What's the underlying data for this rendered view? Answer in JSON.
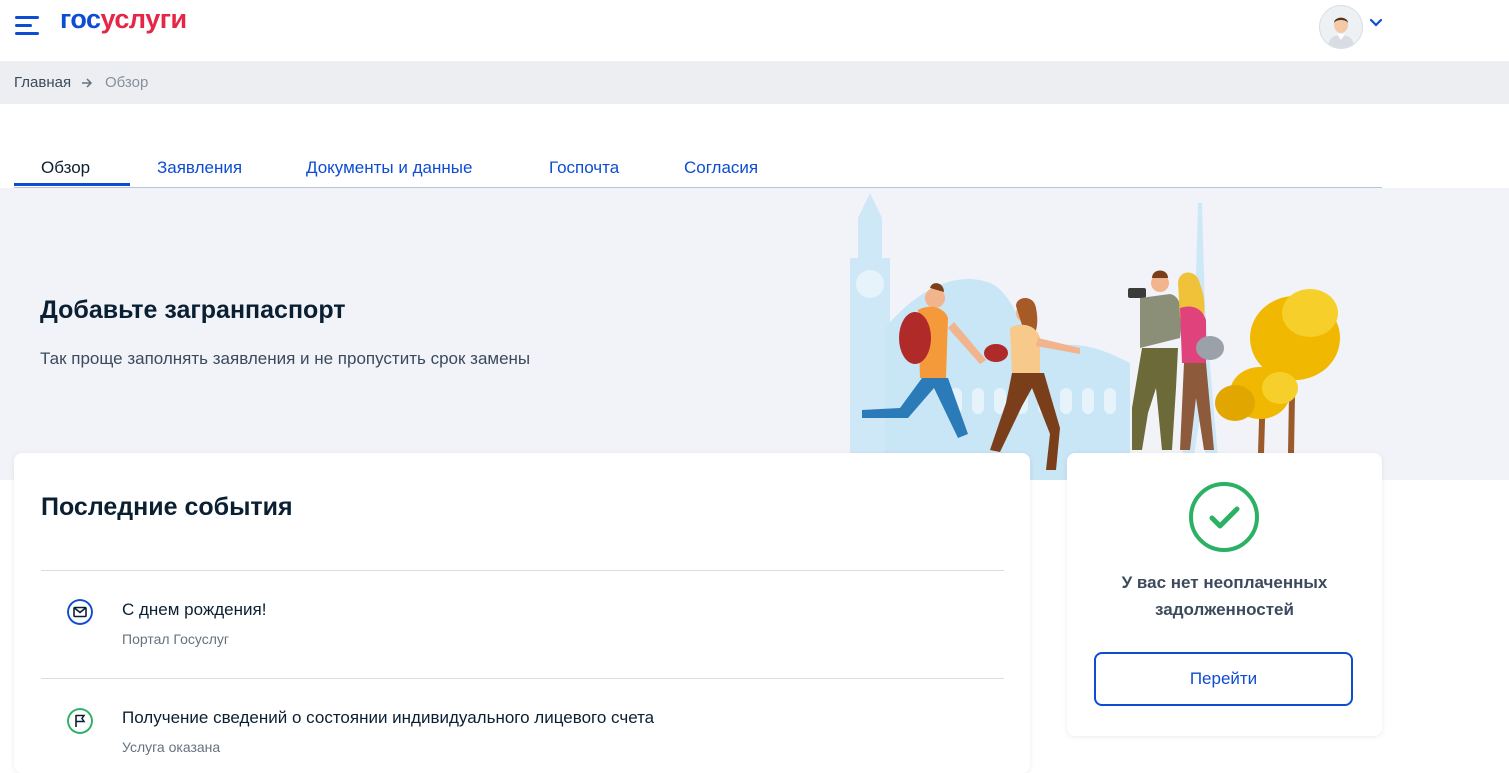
{
  "header": {
    "logo_part1": "гос",
    "logo_part2": "услуги",
    "menu_icon": "hamburger-icon",
    "avatar_icon": "user-avatar",
    "dropdown_icon": "chevron-down-icon"
  },
  "breadcrumb": {
    "home": "Главная",
    "separator_icon": "arrow-right-icon",
    "current": "Обзор"
  },
  "tabs": [
    {
      "label": "Обзор",
      "active": true
    },
    {
      "label": "Заявления",
      "active": false
    },
    {
      "label": "Документы и данные",
      "active": false
    },
    {
      "label": "Госпочта",
      "active": false
    },
    {
      "label": "Согласия",
      "active": false
    }
  ],
  "banner": {
    "title": "Добавьте загранпаспорт",
    "subtitle": "Так проще заполнять заявления и не пропустить срок замены"
  },
  "events": {
    "title": "Последние события",
    "items": [
      {
        "icon": "mail-icon",
        "title": "С днем рождения!",
        "subtitle": "Портал Госуслуг"
      },
      {
        "icon": "flag-icon",
        "title": "Получение сведений о состоянии индивидуального лицевого счета",
        "subtitle": "Услуга оказана"
      }
    ]
  },
  "debt": {
    "icon": "check-circle-icon",
    "text": "У вас нет неоплаченных задолженностей",
    "button_label": "Перейти"
  },
  "colors": {
    "brand_blue": "#0d4cd3",
    "brand_red": "#e62646",
    "success_green": "#2ab164",
    "banner_bg": "#f1f3f8",
    "crumb_bg": "#eceef1"
  }
}
